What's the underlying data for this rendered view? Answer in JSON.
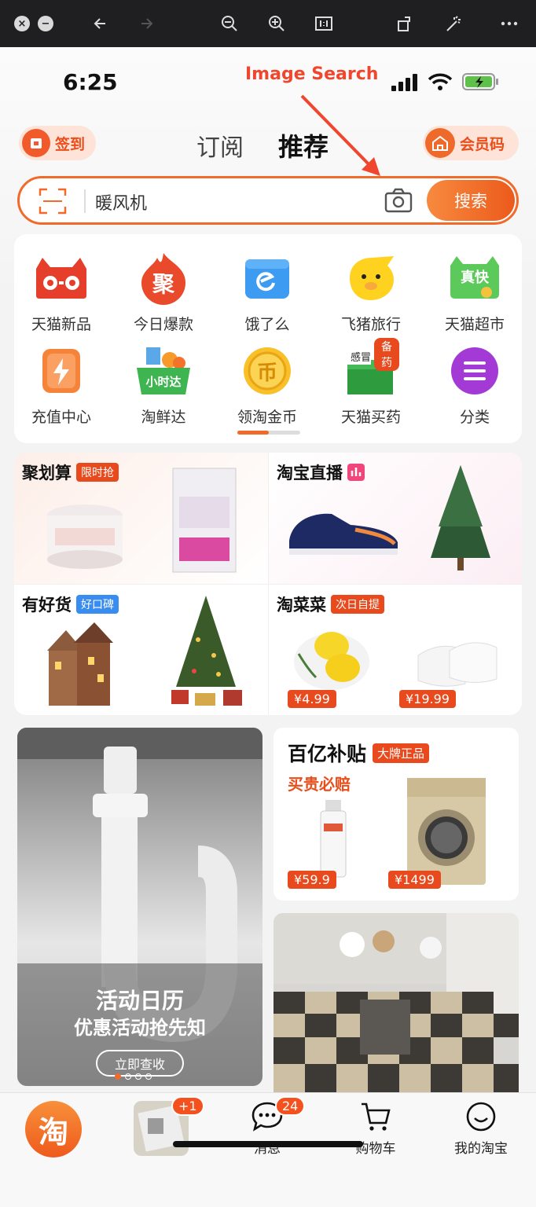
{
  "status": {
    "time": "6:25"
  },
  "annotation": {
    "text": "Image Search"
  },
  "header": {
    "sign_label": "签到",
    "vip_label": "会员码",
    "tabs": [
      {
        "label": "订阅"
      },
      {
        "label": "推荐"
      }
    ]
  },
  "search": {
    "value": "暖风机",
    "button_label": "搜索"
  },
  "quick_links": [
    {
      "label": "天猫新品",
      "icon": "tmall-new-icon"
    },
    {
      "label": "今日爆款",
      "icon": "hot-deal-icon",
      "glyph": "聚"
    },
    {
      "label": "饿了么",
      "icon": "eleme-icon"
    },
    {
      "label": "飞猪旅行",
      "icon": "fliggy-icon"
    },
    {
      "label": "天猫超市",
      "icon": "tmall-market-icon",
      "glyph": "真快"
    },
    {
      "label": "充值中心",
      "icon": "recharge-icon"
    },
    {
      "label": "淘鲜达",
      "icon": "fresh-icon",
      "glyph": "小时达"
    },
    {
      "label": "领淘金币",
      "icon": "coin-icon",
      "glyph": "币"
    },
    {
      "label": "天猫买药",
      "icon": "pharmacy-icon",
      "glyph": "备药",
      "glyph2": "感冒"
    },
    {
      "label": "分类",
      "icon": "category-icon"
    }
  ],
  "promos": [
    {
      "title": "聚划算",
      "tag": "限时抢",
      "tag_color": "#e8491d"
    },
    {
      "title": "淘宝直播",
      "tag": "",
      "tag_color": "#f0467a"
    },
    {
      "title": "有好货",
      "tag": "好口碑",
      "tag_color": "#3a8df0"
    },
    {
      "title": "淘菜菜",
      "tag": "次日自提",
      "tag_color": "#e8491d",
      "prices": [
        "¥4.99",
        "¥19.99"
      ]
    }
  ],
  "feed": {
    "left": {
      "title": "活动日历",
      "subtitle": "优惠活动抢先知",
      "button": "立即查收"
    },
    "subsidy": {
      "title": "百亿补贴",
      "tag": "大牌正品",
      "slogan": "买贵必赔",
      "prices": [
        "¥59.9",
        "¥1499"
      ]
    }
  },
  "tabbar": {
    "home_glyph": "淘",
    "cart_badge": "+1",
    "messages": {
      "label": "消息",
      "badge": "24"
    },
    "cart": {
      "label": "购物车"
    },
    "mine": {
      "label": "我的淘宝"
    }
  },
  "colors": {
    "accent": "#f26a2a",
    "brand_red": "#e8491d"
  }
}
